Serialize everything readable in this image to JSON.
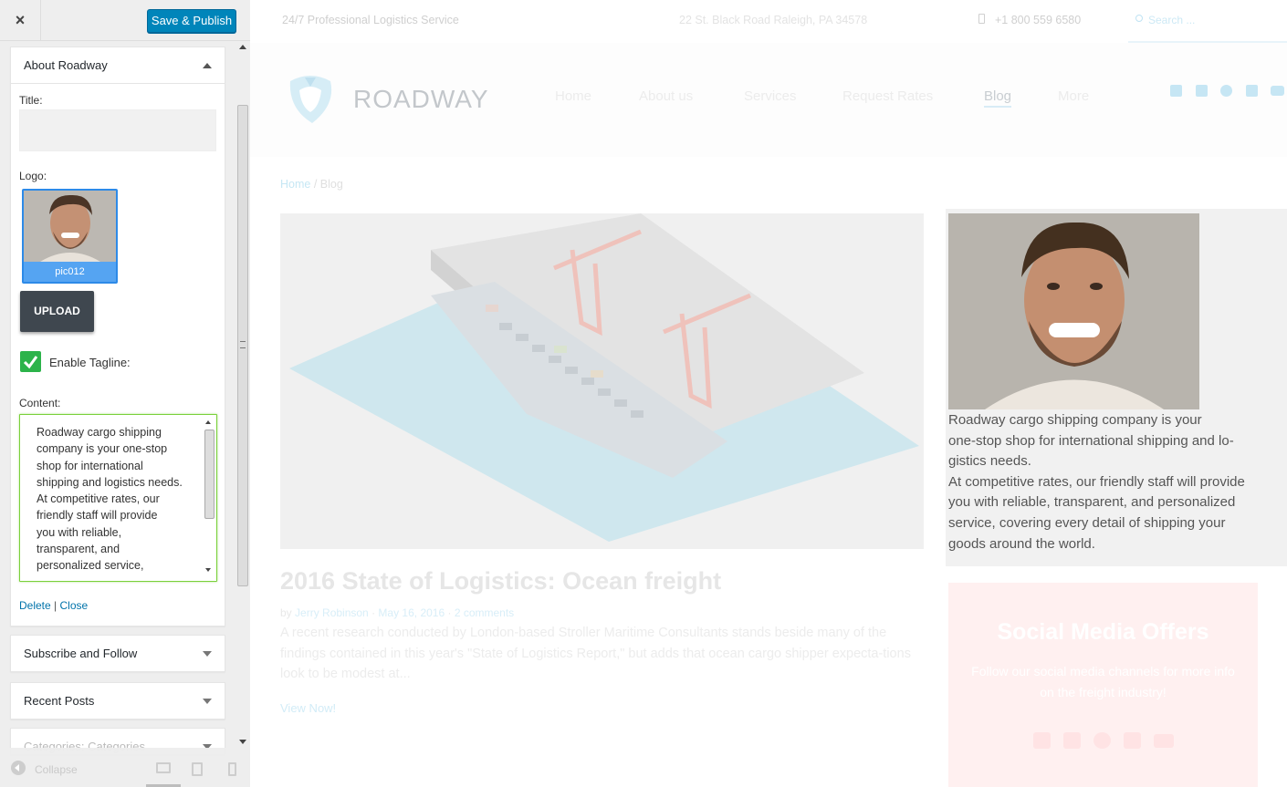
{
  "sidebar": {
    "close_label": "×",
    "publish_label": "Save & Publish",
    "about_widget": {
      "title": "About Roadway",
      "title_field_label": "Title:",
      "title_value": "",
      "logo_label": "Logo:",
      "logo_caption": "pic012",
      "upload_label": "UPLOAD",
      "tagline_label": "Enable Tagline:",
      "tagline_checked": true,
      "content_label": "Content:",
      "content_value": "Roadway cargo shipping\ncompany is your one-stop\nshop for international\nshipping and logistics needs.\nAt competitive rates, our\nfriendly staff will provide\nyou with reliable,\ntransparent, and\npersonalized service,",
      "delete_label": "Delete",
      "separator": "|",
      "close_link_label": "Close"
    },
    "other_widgets": [
      {
        "title": "Subscribe and Follow"
      },
      {
        "title": "Recent Posts"
      },
      {
        "title": "Categories: Categories"
      }
    ],
    "footer": {
      "collapse_label": "Collapse"
    }
  },
  "preview": {
    "topbar": {
      "tagline": "24/7 Professional Logistics Service",
      "address": "22 St. Black Road Raleigh, PA 34578",
      "phone": "+1 800 559 6580",
      "search_placeholder": "Search ..."
    },
    "brand": "ROADWAY",
    "nav": [
      "Home",
      "About us",
      "Services",
      "Request Rates",
      "Blog",
      "More"
    ],
    "breadcrumb": {
      "home": "Home",
      "sep": " / ",
      "current": "Blog"
    },
    "post": {
      "title": "2016 State of Logistics: Ocean freight",
      "meta_by": "by",
      "author": "Jerry Robinson",
      "date": "May 16, 2016",
      "comments": "2 comments",
      "excerpt": "A recent research conducted by London-based Stroller Maritime Consultants stands beside many of the findings contained in this year's \"State of Logistics Report,\" but adds that ocean cargo shipper expecta-tions look to be modest at...",
      "read_more": "View Now!"
    },
    "about_card": {
      "text": "Roadway cargo shipping company is your\none-stop shop for international shipping and lo-\ngistics needs.\nAt competitive rates, our friendly staff will provide\nyou with reliable, transparent, and personalized\nservice, covering every detail of shipping your\ngoods around the world."
    },
    "offer": {
      "title": "Social Media Offers",
      "text": "Follow our social media channels for more info on the freight industry!"
    },
    "colors": {
      "accent": "#0085ba",
      "checkbox": "#2cb34a",
      "link": "#0073aa"
    }
  }
}
